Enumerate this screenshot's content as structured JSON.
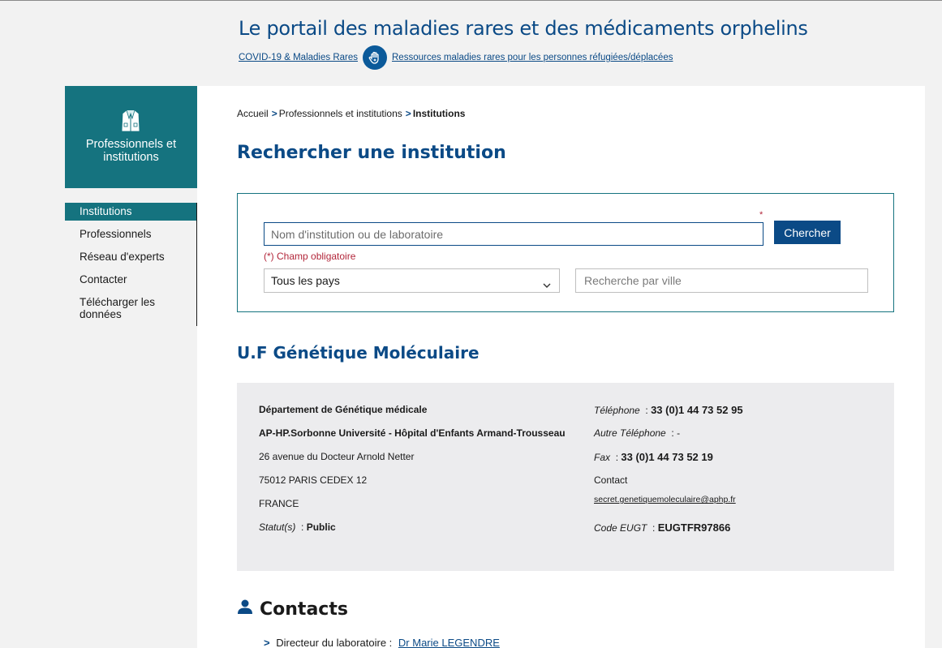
{
  "header": {
    "site_title": "Le portail des maladies rares et des médicaments orphelins",
    "banner_link_1": "COVID-19 & Maladies Rares",
    "banner_icon": "helping-hand-icon",
    "banner_link_2": "Ressources maladies rares pour les personnes réfugiées/déplacées"
  },
  "sidebar": {
    "section_icon": "lab-coat-icon",
    "section_title": "Professionnels et institutions",
    "items": [
      {
        "label": "Institutions",
        "active": true
      },
      {
        "label": "Professionnels"
      },
      {
        "label": "Réseau d'experts"
      },
      {
        "label": "Contacter"
      },
      {
        "label": "Télécharger les données"
      }
    ]
  },
  "breadcrumb": {
    "home": "Accueil",
    "section": "Professionnels et institutions",
    "current": "Institutions",
    "separator": ">"
  },
  "page_title": "Rechercher une institution",
  "search": {
    "required_star": "*",
    "name_placeholder": "Nom d'institution ou de laboratoire",
    "name_value": "",
    "search_button": "Chercher",
    "required_note": "(*) Champ obligatoire",
    "country_selected": "Tous les pays",
    "city_placeholder": "Recherche par ville",
    "city_value": ""
  },
  "institution": {
    "name": "U.F Génétique Moléculaire",
    "department": "Département de Génétique médicale",
    "hospital": "AP-HP.Sorbonne Université - Hôpital d'Enfants Armand-Trousseau",
    "address": "26 avenue du Docteur Arnold Netter",
    "postal_city": "75012 PARIS CEDEX 12",
    "country": "FRANCE",
    "status_label": "Statut(s)",
    "status_value": "Public",
    "phone_label": "Téléphone",
    "phone_value": "33 (0)1 44 73 52 95",
    "other_phone_label": "Autre Téléphone",
    "other_phone_value": "-",
    "fax_label": "Fax",
    "fax_value": "33 (0)1 44 73 52 19",
    "contact_label": "Contact",
    "contact_email": "secret.genetiquemoleculaire@aphp.fr",
    "code_label": "Code EUGT",
    "code_value": "EUGTFR97866",
    "colon": ":"
  },
  "contacts": {
    "title": "Contacts",
    "icon": "person-icon",
    "items": [
      {
        "role": "Directeur du laboratoire :",
        "name": "Dr Marie LEGENDRE"
      }
    ]
  },
  "colors": {
    "brand_blue": "#0b4a86",
    "teal": "#15737f",
    "required_red": "#b2263a",
    "card_bg": "#ececee"
  }
}
